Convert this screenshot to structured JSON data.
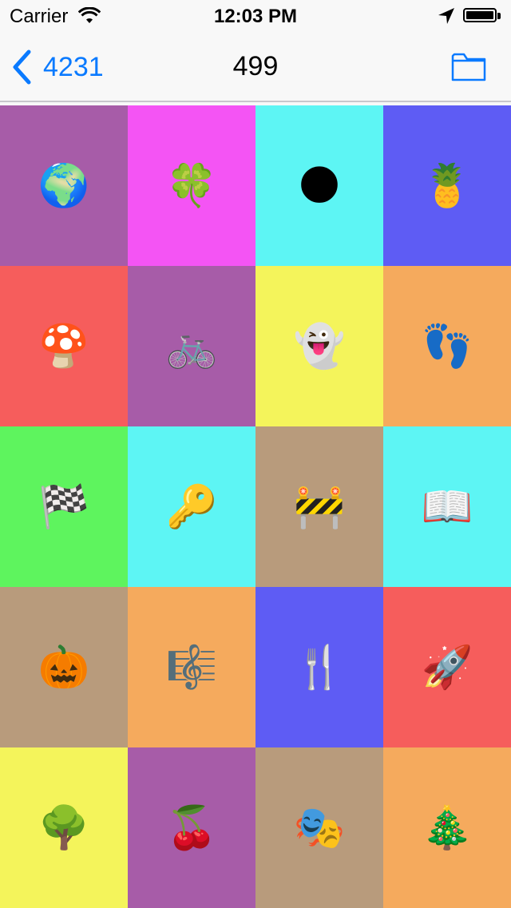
{
  "status_bar": {
    "carrier": "Carrier",
    "time": "12:03 PM"
  },
  "nav": {
    "back_label": "4231",
    "title": "499",
    "folder_icon": "folder-icon",
    "tint_color": "#0a7aff"
  },
  "grid": {
    "cells": [
      {
        "emoji": "🌍",
        "icon": "globe-icon",
        "color": "#a75ca8"
      },
      {
        "emoji": "🍀",
        "icon": "four-leaf-clover-icon",
        "color": "#f454f4"
      },
      {
        "emoji": "🌑",
        "icon": "new-moon-face-icon",
        "color": "#5df5f4"
      },
      {
        "emoji": "🍍",
        "icon": "pineapple-icon",
        "color": "#5e5cf4"
      },
      {
        "emoji": "🍄",
        "icon": "mushroom-icon",
        "color": "#f65d5c"
      },
      {
        "emoji": "🚲",
        "icon": "bicycle-icon",
        "color": "#a75ca8"
      },
      {
        "emoji": "👻",
        "icon": "ghost-icon",
        "color": "#f4f45b"
      },
      {
        "emoji": "👣",
        "icon": "footprints-icon",
        "color": "#f5aa5d"
      },
      {
        "emoji": "🏁",
        "icon": "checkered-flag-icon",
        "color": "#5ef45e"
      },
      {
        "emoji": "🔑",
        "icon": "key-icon",
        "color": "#5df5f4"
      },
      {
        "emoji": "🚧",
        "icon": "construction-barrier-icon",
        "color": "#b89b7c"
      },
      {
        "emoji": "📖",
        "icon": "open-book-icon",
        "color": "#5df5f4"
      },
      {
        "emoji": "🎃",
        "icon": "jack-o-lantern-icon",
        "color": "#b89b7c"
      },
      {
        "emoji": "🎼",
        "icon": "musical-score-icon",
        "color": "#f5aa5d"
      },
      {
        "emoji": "🍴",
        "icon": "fork-and-knife-icon",
        "color": "#5e5cf4"
      },
      {
        "emoji": "🚀",
        "icon": "rocket-icon",
        "color": "#f65d5c"
      },
      {
        "emoji": "🌳",
        "icon": "deciduous-tree-icon",
        "color": "#f4f45b"
      },
      {
        "emoji": "🍒",
        "icon": "cherries-icon",
        "color": "#a75ca8"
      },
      {
        "emoji": "🎭",
        "icon": "performing-arts-icon",
        "color": "#b89b7c"
      },
      {
        "emoji": "🎄",
        "icon": "christmas-tree-icon",
        "color": "#f5aa5d"
      }
    ]
  }
}
